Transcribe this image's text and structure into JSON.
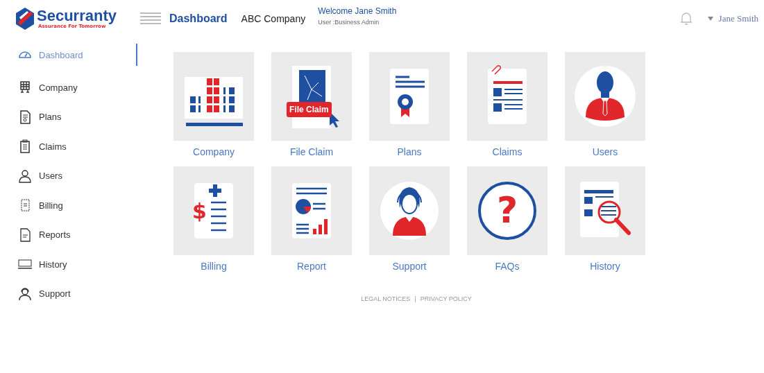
{
  "header": {
    "logo": {
      "name": "Securranty",
      "tagline": "Assurance For Tomorrow"
    },
    "page_title": "Dashboard",
    "company": "ABC Company",
    "welcome": "Welcome Jane Smith",
    "role": "User :Business Admin",
    "user_menu": "Jane Smith"
  },
  "sidebar": {
    "items": [
      {
        "label": "Dashboard",
        "kind": "dashboard",
        "selected": true
      },
      {
        "label": "Company",
        "kind": "company",
        "selected": false
      },
      {
        "label": "Plans",
        "kind": "plans",
        "selected": false
      },
      {
        "label": "Claims",
        "kind": "claims",
        "selected": false
      },
      {
        "label": "Users",
        "kind": "users",
        "selected": false
      },
      {
        "label": "Billing",
        "kind": "billing",
        "selected": false
      },
      {
        "label": "Reports",
        "kind": "reports",
        "selected": false
      },
      {
        "label": "History",
        "kind": "history",
        "selected": false
      },
      {
        "label": "Support",
        "kind": "support",
        "selected": false
      }
    ]
  },
  "tiles": [
    {
      "label": "Company",
      "kind": "company"
    },
    {
      "label": "File Claim",
      "kind": "fileclaim",
      "badge": "File Claim"
    },
    {
      "label": "Plans",
      "kind": "plans"
    },
    {
      "label": "Claims",
      "kind": "claims"
    },
    {
      "label": "Users",
      "kind": "users"
    },
    {
      "label": "Billing",
      "kind": "billing",
      "symbol": "$"
    },
    {
      "label": "Report",
      "kind": "report"
    },
    {
      "label": "Support",
      "kind": "support"
    },
    {
      "label": "FAQs",
      "kind": "faqs",
      "symbol": "?"
    },
    {
      "label": "History",
      "kind": "history"
    }
  ],
  "footer": {
    "links": [
      "LEGAL NOTICES",
      "PRIVACY POLICY"
    ],
    "separator": "|"
  }
}
